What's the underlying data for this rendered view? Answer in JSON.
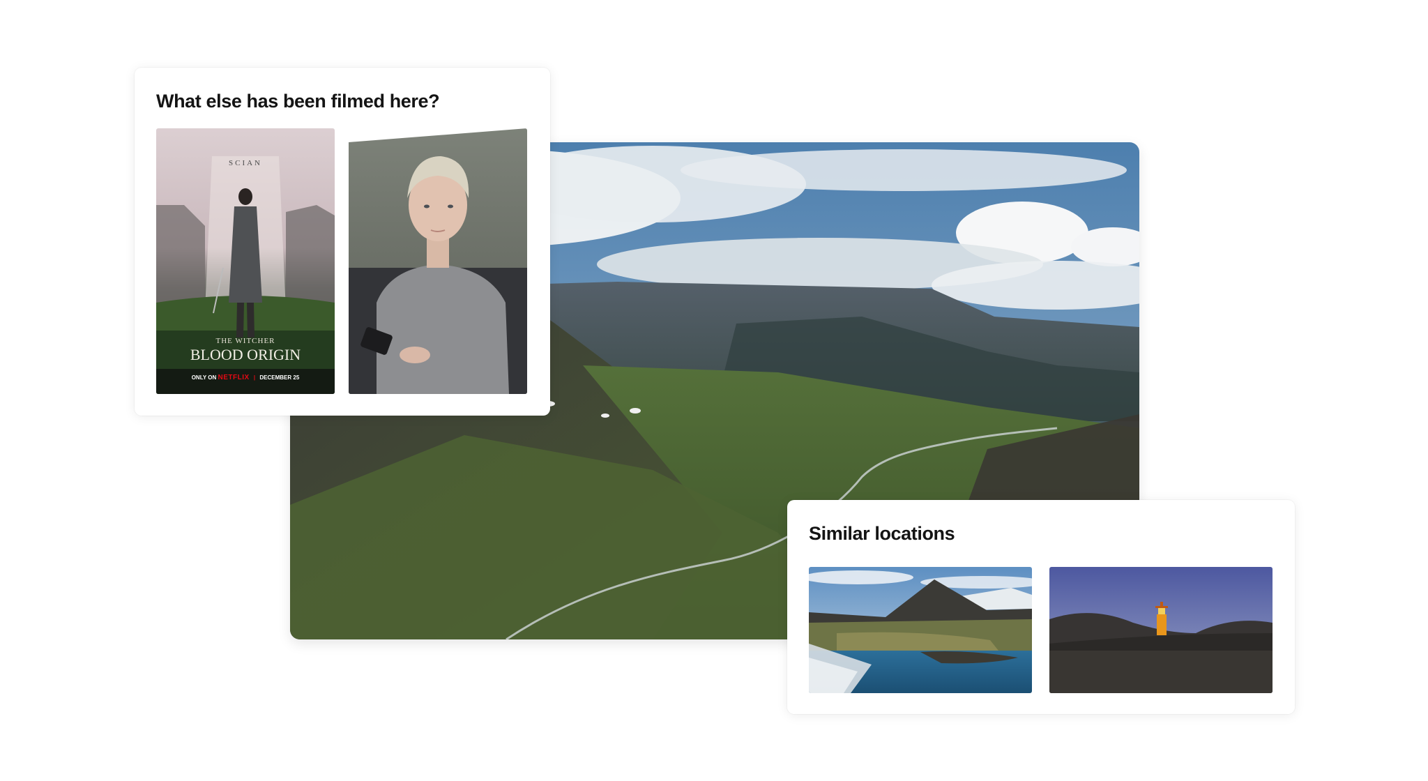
{
  "filmed": {
    "title": "What else has been filmed here?",
    "items": [
      {
        "kind": "poster",
        "top_text": "SCIAN",
        "series": "THE WITCHER",
        "title": "BLOOD ORIGIN",
        "footer_only_on": "ONLY ON",
        "footer_brand": "NETFLIX",
        "footer_sep": "|",
        "footer_date": "DECEMBER 25"
      },
      {
        "kind": "still"
      }
    ]
  },
  "similar": {
    "title": "Similar locations",
    "items": [
      {
        "kind": "mountain-coast"
      },
      {
        "kind": "lighthouse"
      }
    ]
  }
}
